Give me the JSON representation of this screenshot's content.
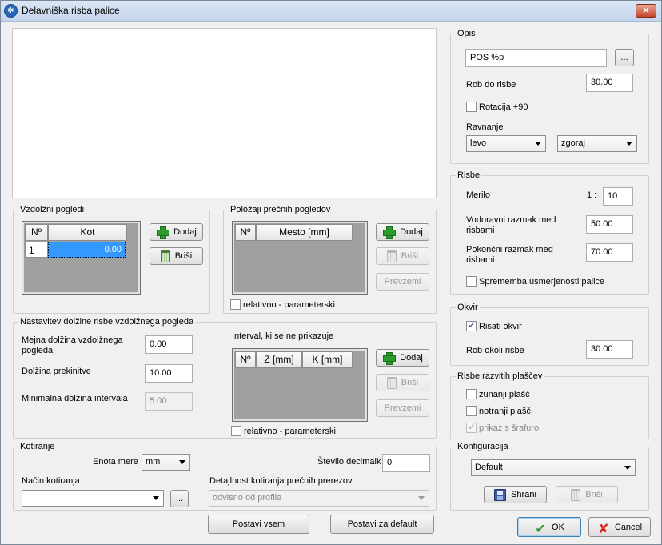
{
  "window": {
    "title": "Delavniška risba palice",
    "icon": "app-logo-icon",
    "close_glyph": "✕"
  },
  "longitudinal_views": {
    "title": "Vzdolžni pogledi",
    "columns": [
      "Nº",
      "Kot"
    ],
    "rows": [
      {
        "no": "1",
        "kot": "0.00"
      }
    ],
    "add_label": "Dodaj",
    "delete_label": "Briši"
  },
  "cross_section_positions": {
    "title": "Položaji prečnih pogledov",
    "columns": [
      "Nº",
      "Mesto [mm]"
    ],
    "add_label": "Dodaj",
    "delete_label": "Briši",
    "take_label": "Prevzemi",
    "relative_label": "relativno - parameterski"
  },
  "length_settings": {
    "title": "Nastavitev dolžine risbe vzdolžnega pogleda",
    "limit_length_label": "Mejna dolžina vzdolžnega pogleda",
    "limit_length_value": "0.00",
    "break_length_label": "Dolžina prekinitve",
    "break_length_value": "10.00",
    "min_interval_label": "Minimalna dolžina intervala",
    "min_interval_value": "5.00",
    "hidden_interval_title": "Interval, ki se ne prikazuje",
    "hidden_interval_columns": [
      "Nº",
      "Z [mm]",
      "K [mm]"
    ],
    "add_label": "Dodaj",
    "delete_label": "Briši",
    "take_label": "Prevzemi",
    "relative_label": "relativno - parameterski"
  },
  "dimensioning": {
    "title": "Kotiranje",
    "unit_label": "Enota mere",
    "unit_value": "mm",
    "decimals_label": "Število decimalk",
    "decimals_value": "0",
    "method_label": "Način kotiranja",
    "method_value": "",
    "method_more": "...",
    "detail_label": "Detajlnost kotiranja prečnih prerezov",
    "detail_value": "odvisno od profila"
  },
  "footer": {
    "apply_all_label": "Postavi vsem",
    "set_default_label": "Postavi za default",
    "ok_label": "OK",
    "cancel_label": "Cancel"
  },
  "description": {
    "title": "Opis",
    "text_value": "POS %p",
    "more_button": "...",
    "edge_label": "Rob do risbe",
    "edge_value": "30.00",
    "rotation_label": "Rotacija +90",
    "rotation_checked": false,
    "alignment_label": "Ravnanje",
    "h_align_value": "levo",
    "v_align_value": "zgoraj"
  },
  "drawings": {
    "title": "Risbe",
    "scale_label": "Merilo",
    "scale_prefix": "1 :",
    "scale_value": "10",
    "h_spacing_label": "Vodoravni razmak med risbami",
    "h_spacing_value": "50.00",
    "v_spacing_label": "Pokončni razmak med risbami",
    "v_spacing_value": "70.00",
    "orientation_label": "Sprememba usmerjenosti palice",
    "orientation_checked": false
  },
  "frame": {
    "title": "Okvir",
    "draw_frame_label": "Risati okvir",
    "draw_frame_checked": true,
    "edge_label": "Rob okoli risbe",
    "edge_value": "30.00"
  },
  "sheathing": {
    "title": "Risbe razvitih plaščev",
    "outer_label": "zunanji plašč",
    "inner_label": "notranji plašč",
    "hatch_label": "prikaz s šrafuro",
    "hatch_checked": true
  },
  "configuration": {
    "title": "Konfiguracija",
    "selected": "Default",
    "save_label": "Shrani",
    "delete_label": "Briši"
  }
}
